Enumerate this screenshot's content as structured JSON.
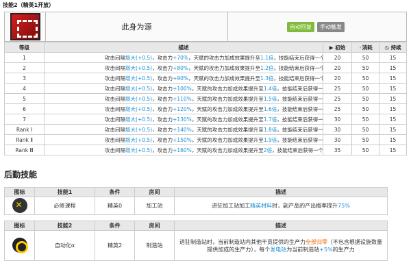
{
  "skill": {
    "title": "技能2（精英1开放）",
    "name": "此身为源",
    "tags": [
      "自动回复",
      "手动触发"
    ]
  },
  "levels": {
    "headers": {
      "level": "等级",
      "desc": "描述",
      "init": "初始",
      "cost": "消耗",
      "duration": "持续"
    },
    "rows": [
      {
        "level": "1",
        "inc": "增大(+0.5)",
        "atk": "+70%",
        "mult": "1.1倍",
        "init": "20",
        "cost": "50",
        "duration": "15"
      },
      {
        "level": "2",
        "inc": "增大(+0.5)",
        "atk": "+80%",
        "mult": "1.2倍",
        "init": "20",
        "cost": "50",
        "duration": "15"
      },
      {
        "level": "3",
        "inc": "增大(+0.5)",
        "atk": "+90%",
        "mult": "1.3倍",
        "init": "20",
        "cost": "50",
        "duration": "15"
      },
      {
        "level": "4",
        "inc": "增大(+0.5)",
        "atk": "+100%",
        "mult": "1.4倍",
        "init": "25",
        "cost": "50",
        "duration": "15"
      },
      {
        "level": "5",
        "inc": "增大(+0.5)",
        "atk": "+110%",
        "mult": "1.5倍",
        "init": "25",
        "cost": "50",
        "duration": "15"
      },
      {
        "level": "6",
        "inc": "增大(+0.5)",
        "atk": "+120%",
        "mult": "1.6倍",
        "init": "25",
        "cost": "50",
        "duration": "15"
      },
      {
        "level": "7",
        "inc": "增大(+0.5)",
        "atk": "+130%",
        "mult": "1.7倍",
        "init": "30",
        "cost": "50",
        "duration": "15"
      },
      {
        "level": "Rank Ⅰ",
        "inc": "增大(+0.5)",
        "atk": "+140%",
        "mult": "1.8倍",
        "init": "30",
        "cost": "50",
        "duration": "15"
      },
      {
        "level": "Rank Ⅱ",
        "inc": "增大(+0.5)",
        "atk": "+150%",
        "mult": "1.9倍",
        "init": "30",
        "cost": "50",
        "duration": "15"
      },
      {
        "level": "Rank Ⅲ",
        "inc": "增大(+0.5)",
        "atk": "+160%",
        "mult": "2倍",
        "init": "35",
        "cost": "50",
        "duration": "15"
      }
    ],
    "desc_parts": {
      "p1": "攻击间隔",
      "p2": "，攻击力",
      "p3": "，天赋的攻击力加成效果提升至",
      "p4": "，技能结束后获得一个可靠电池"
    }
  },
  "logistics": {
    "title": "后勤技能",
    "table1": {
      "headers": [
        "图标",
        "技能1",
        "条件",
        "房间",
        "描述"
      ],
      "skill": "必修课程",
      "cond": "精英0",
      "room": "加工站",
      "desc_a": "进驻加工站加工",
      "desc_b": "精英材料",
      "desc_c": "时，副产品的产出概率提升",
      "desc_d": "75%"
    },
    "table2": {
      "headers": [
        "图标",
        "技能2",
        "条件",
        "房间",
        "描述"
      ],
      "skill": "自动化α",
      "cond": "精英2",
      "room": "制造站",
      "desc_a": "进驻制造站时，当前制造站内其他干员提供的生产力",
      "desc_b": "全部归零",
      "desc_c": "（不包含根据设施数量提供加成的生产力），每个",
      "desc_d": "发电站",
      "desc_e": "为当前制造站",
      "desc_f": "+5%",
      "desc_g": "的生产力"
    }
  }
}
